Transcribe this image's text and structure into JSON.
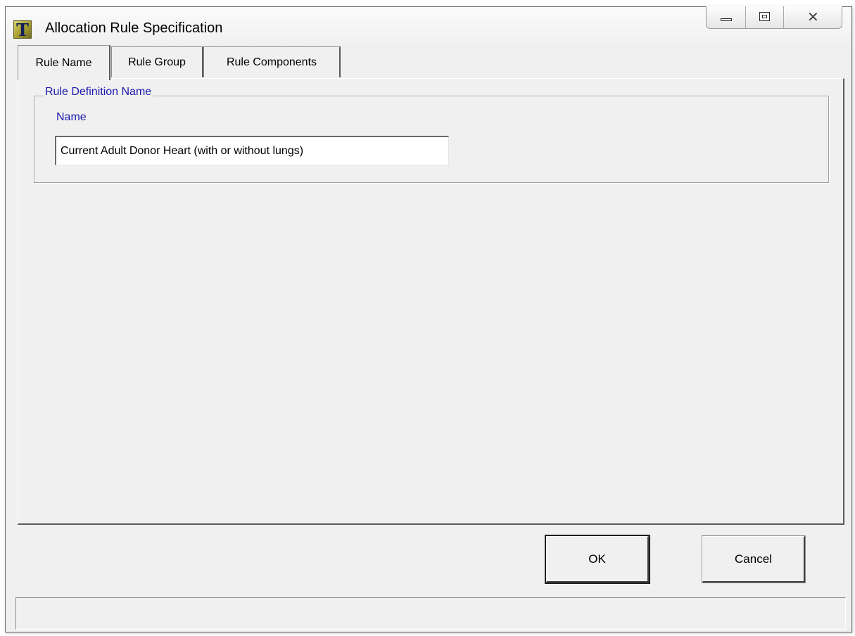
{
  "window": {
    "title": "Allocation Rule Specification",
    "icon_letter": "T"
  },
  "tabs": [
    {
      "label": "Rule Name",
      "active": true
    },
    {
      "label": "Rule Group",
      "active": false
    },
    {
      "label": "Rule Components",
      "active": false
    }
  ],
  "rule_definition": {
    "group_label": "Rule Definition Name",
    "name_label": "Name",
    "name_value": "Current Adult Donor Heart (with or without lungs)"
  },
  "buttons": {
    "ok_label": "OK",
    "cancel_label": "Cancel"
  },
  "colors": {
    "label_blue": "#1a1ab0",
    "dialog_bg": "#f0f0f0"
  }
}
